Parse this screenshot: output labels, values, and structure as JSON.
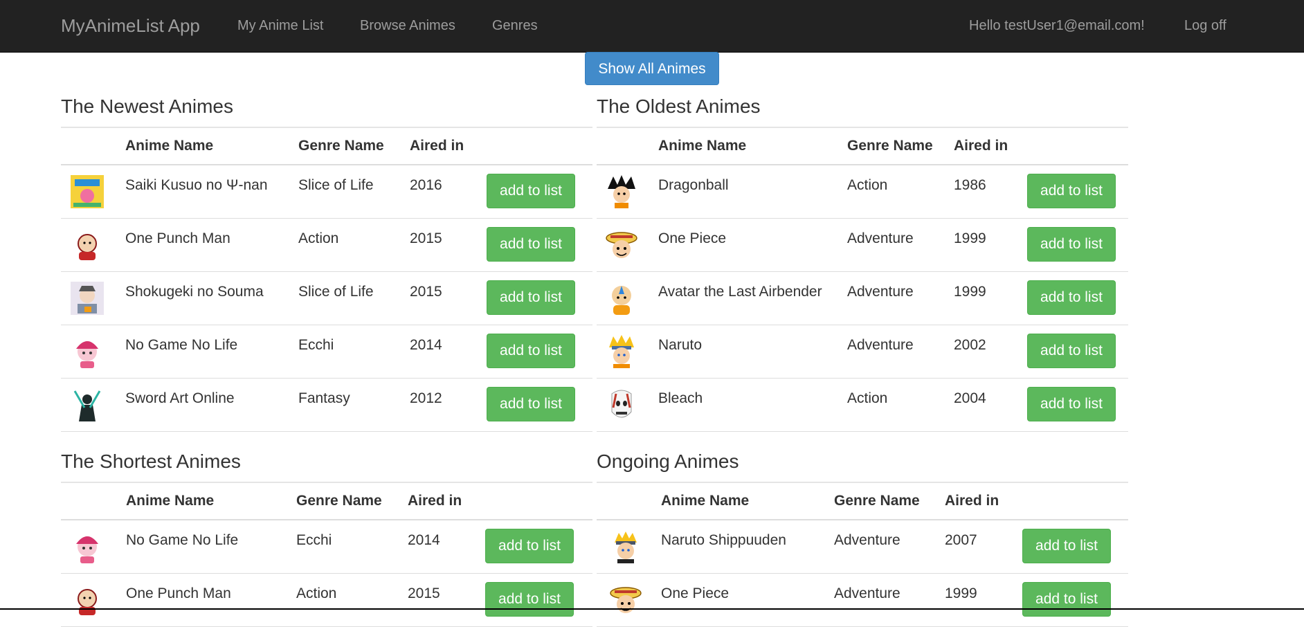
{
  "nav": {
    "brand": "MyAnimeList App",
    "links": [
      "My Anime List",
      "Browse Animes",
      "Genres"
    ],
    "greeting": "Hello testUser1@email.com!",
    "logoff": "Log off"
  },
  "show_all_label": "Show All Animes",
  "columns": {
    "name": "Anime Name",
    "genre": "Genre Name",
    "aired": "Aired in"
  },
  "add_label": "add to list",
  "sections": {
    "newest": {
      "title": "The Newest Animes",
      "rows": [
        {
          "name": "Saiki Kusuo no Ψ-nan",
          "genre": "Slice of Life",
          "aired": "2016",
          "thumb": "saiki-thumbnail"
        },
        {
          "name": "One Punch Man",
          "genre": "Action",
          "aired": "2015",
          "thumb": "saitama-thumbnail"
        },
        {
          "name": "Shokugeki no Souma",
          "genre": "Slice of Life",
          "aired": "2015",
          "thumb": "souma-thumbnail"
        },
        {
          "name": "No Game No Life",
          "genre": "Ecchi",
          "aired": "2014",
          "thumb": "ngnl-thumbnail"
        },
        {
          "name": "Sword Art Online",
          "genre": "Fantasy",
          "aired": "2012",
          "thumb": "sao-thumbnail"
        }
      ]
    },
    "oldest": {
      "title": "The Oldest Animes",
      "rows": [
        {
          "name": "Dragonball",
          "genre": "Action",
          "aired": "1986",
          "thumb": "goku-thumbnail"
        },
        {
          "name": "One Piece",
          "genre": "Adventure",
          "aired": "1999",
          "thumb": "luffy-thumbnail"
        },
        {
          "name": "Avatar the Last Airbender",
          "genre": "Adventure",
          "aired": "1999",
          "thumb": "aang-thumbnail"
        },
        {
          "name": "Naruto",
          "genre": "Adventure",
          "aired": "2002",
          "thumb": "naruto-thumbnail"
        },
        {
          "name": "Bleach",
          "genre": "Action",
          "aired": "2004",
          "thumb": "hollow-mask-thumbnail"
        }
      ]
    },
    "shortest": {
      "title": "The Shortest Animes",
      "rows": [
        {
          "name": "No Game No Life",
          "genre": "Ecchi",
          "aired": "2014",
          "thumb": "ngnl-thumbnail"
        },
        {
          "name": "One Punch Man",
          "genre": "Action",
          "aired": "2015",
          "thumb": "saitama-thumbnail"
        }
      ]
    },
    "ongoing": {
      "title": "Ongoing Animes",
      "rows": [
        {
          "name": "Naruto Shippuuden",
          "genre": "Adventure",
          "aired": "2007",
          "thumb": "naruto-shippuuden-thumbnail"
        },
        {
          "name": "One Piece",
          "genre": "Adventure",
          "aired": "1999",
          "thumb": "luffy-thumbnail"
        }
      ]
    }
  }
}
